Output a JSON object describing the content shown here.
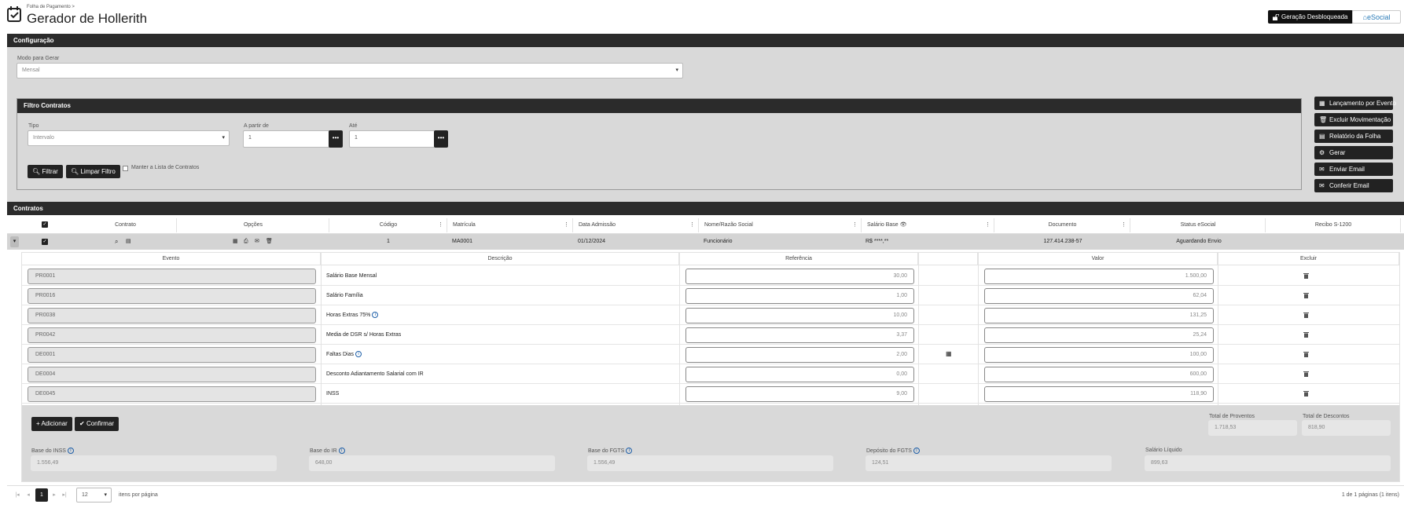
{
  "header": {
    "breadcrumb": "Folha de Pagamento",
    "breadcrumb_sep": ">",
    "title": "Gerador de Hollerith",
    "btn_unlocked": "Geração Desbloqueada",
    "btn_esocial": "eSocial"
  },
  "config": {
    "section_title": "Configuração",
    "mode_label": "Modo para Gerar",
    "mode_value": "Mensal"
  },
  "filter": {
    "section_title": "Filtro Contratos",
    "tipo_label": "Tipo",
    "tipo_value": "Intervalo",
    "from_label": "A partir de",
    "from_value": "1",
    "to_label": "Até",
    "to_value": "1",
    "filter_btn": "Filtrar",
    "clear_btn": "Limpar Filtro",
    "keep_list_label": "Manter a Lista de Contratos"
  },
  "side_buttons": [
    "Lançamento por Evento",
    "Excluir Movimentação",
    "Relatório da Folha",
    "Gerar",
    "Enviar Email",
    "Conferir Email"
  ],
  "contracts": {
    "section_title": "Contratos",
    "columns": [
      "Contrato",
      "Opções",
      "Código",
      "Matrícula",
      "Data Admissão",
      "Nome/Razão Social",
      "Salário Base",
      "Documento",
      "Status eSocial",
      "Recibo S-1200"
    ],
    "row": {
      "codigo": "1",
      "matricula": "MA0001",
      "data_admissao": "01/12/2024",
      "nome": "Funcionário",
      "salario": "R$ ****,**",
      "documento": "127.414.238-57",
      "status": "Aguardando Envio",
      "recibo": ""
    }
  },
  "events": {
    "columns": [
      "Evento",
      "Descrição",
      "Referência",
      "Valor",
      "Excluir"
    ],
    "rows": [
      {
        "code": "PR0001",
        "desc": "Salário Base Mensal",
        "ref": "30,00",
        "val": "1.500,00",
        "info": false,
        "calc": false
      },
      {
        "code": "PR0016",
        "desc": "Salário Família",
        "ref": "1,00",
        "val": "62,04",
        "info": false,
        "calc": false
      },
      {
        "code": "PR0038",
        "desc": "Horas Extras 75%",
        "ref": "10,00",
        "val": "131,25",
        "info": true,
        "calc": false
      },
      {
        "code": "PR0042",
        "desc": "Media de DSR s/ Horas Extras",
        "ref": "3,37",
        "val": "25,24",
        "info": false,
        "calc": false
      },
      {
        "code": "DE0001",
        "desc": "Faltas Dias",
        "ref": "2,00",
        "val": "100,00",
        "info": true,
        "calc": true
      },
      {
        "code": "DE0004",
        "desc": "Desconto Adiantamento Salarial com IR",
        "ref": "0,00",
        "val": "600,00",
        "info": false,
        "calc": false
      },
      {
        "code": "DE0045",
        "desc": "INSS",
        "ref": "9,00",
        "val": "118,90",
        "info": false,
        "calc": false
      }
    ],
    "add_btn": "Adicionar",
    "confirm_btn": "Confirmar"
  },
  "totals": {
    "proventos_label": "Total de Proventos",
    "proventos_value": "1.718,53",
    "descontos_label": "Total de Descontos",
    "descontos_value": "818,90",
    "inss_label": "Base do INSS",
    "inss_value": "1.556,49",
    "ir_label": "Base do IR",
    "ir_value": "648,00",
    "fgts_label": "Base do FGTS",
    "fgts_value": "1.556,49",
    "deposito_label": "Depósito do FGTS",
    "deposito_value": "124,51",
    "liquido_label": "Salário Líquido",
    "liquido_value": "899,63"
  },
  "pagination": {
    "current_page": "1",
    "page_size": "12",
    "per_page_label": "itens por página",
    "summary": "1 de 1 páginas (1 itens)"
  },
  "colors": {
    "dark": "#222222",
    "panel": "#d9d9d9",
    "accent": "#1e5fa8"
  }
}
